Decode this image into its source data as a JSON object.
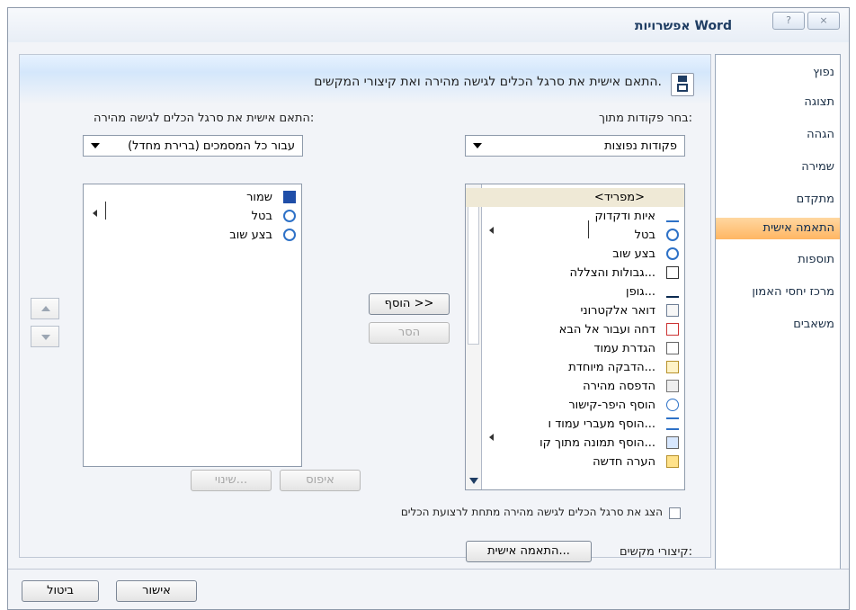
{
  "window": {
    "title": "אפשרויות Word",
    "help_glyph": "?",
    "close_glyph": "×"
  },
  "sidebar": {
    "items": [
      {
        "label": "נפוץ"
      },
      {
        "label": "תצוגה"
      },
      {
        "label": "הגהה"
      },
      {
        "label": "שמירה"
      },
      {
        "label": "מתקדם"
      },
      {
        "label": "התאמה אישית"
      },
      {
        "label": "תוספות"
      },
      {
        "label": "מרכז יחסי האמון"
      },
      {
        "label": "משאבים"
      }
    ],
    "active_index": 5
  },
  "main": {
    "header": "התאם אישית את סרגל הכלים לגישה מהירה ואת קיצורי המקשים.",
    "choose_label": "בחר פקודות מתוך:",
    "choose_value": "פקודות נפוצות",
    "customize_label": "התאם אישית את סרגל הכלים לגישה מהירה:",
    "customize_value": "עבור כל המסמכים (ברירת מחדל)",
    "left_list": [
      "<מפריד>",
      "איות ודקדוק",
      "בטל",
      "בצע שוב",
      "גבולות והצללה...",
      "גופן...",
      "דואר אלקטרוני",
      "דחה ועבור אל הבא",
      "הגדרת עמוד",
      "הדבקה מיוחדת...",
      "הדפסה מהירה",
      "הוסף היפר-קישור",
      "הוסף מעברי עמוד ו...",
      "הוסף תמונה מתוך קו...",
      "הערה חדשה"
    ],
    "right_list": [
      "שמור",
      "בטל",
      "בצע שוב"
    ],
    "add_button": "הוסף >>",
    "remove_button": "הסר",
    "reset_button": "איפוס",
    "modify_button": "שינוי...",
    "checkbox_label": "הצג את סרגל הכלים לגישה מהירה מתחת לרצועת הכלים",
    "shortcuts_label": "קיצורי מקשים:",
    "shortcuts_button": "התאמה אישית..."
  },
  "footer": {
    "ok": "אישור",
    "cancel": "ביטול"
  },
  "colors": {
    "active_bg": "#ffb663",
    "frame": "#8e9aab",
    "header_band": "#d4e7fb"
  }
}
